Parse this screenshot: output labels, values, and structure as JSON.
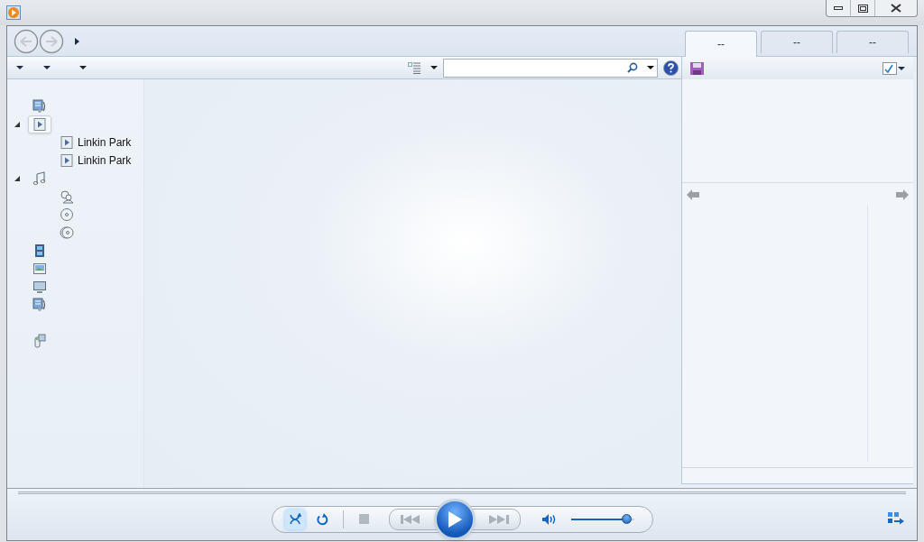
{
  "tabs": [
    {
      "label": "--",
      "selected": true
    },
    {
      "label": "--",
      "selected": false
    },
    {
      "label": "--",
      "selected": false
    }
  ],
  "nav_tree": [
    {
      "kind": "media",
      "selected": false
    },
    {
      "kind": "playlist",
      "selected": true,
      "expanded": true,
      "children": [
        {
          "kind": "playlist-item",
          "label": "Linkin Park",
          "selected": false
        },
        {
          "kind": "playlist-item",
          "label": "Linkin Park",
          "selected": false
        }
      ]
    },
    {
      "kind": "music",
      "selected": false,
      "expanded": true,
      "children": [
        {
          "kind": "artist",
          "selected": false
        },
        {
          "kind": "album",
          "selected": false
        },
        {
          "kind": "genre",
          "selected": false
        }
      ]
    },
    {
      "kind": "video",
      "selected": false
    },
    {
      "kind": "picture",
      "selected": false
    },
    {
      "kind": "tv",
      "selected": false
    },
    {
      "kind": "media",
      "selected": false
    },
    {
      "kind": "device",
      "selected": false
    }
  ],
  "player": {
    "shuffle": true,
    "repeat": false,
    "volume": {
      "level": 0.88
    }
  }
}
